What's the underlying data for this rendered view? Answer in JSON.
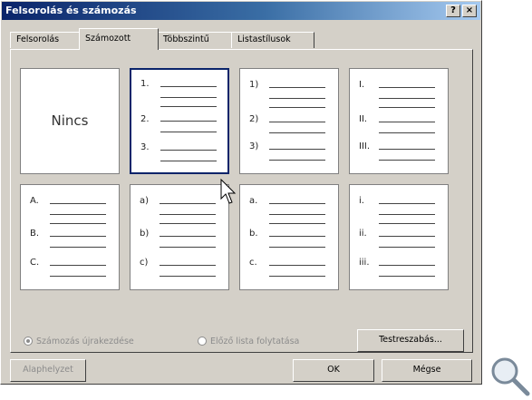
{
  "window": {
    "title": "Felsorolás és számozás",
    "help_icon": "?",
    "close_icon": "×"
  },
  "tabs": [
    {
      "label": "Felsorolás"
    },
    {
      "label": "Számozott"
    },
    {
      "label": "Többszintű"
    },
    {
      "label": "Listastílusok"
    }
  ],
  "gallery": {
    "none_label": "Nincs",
    "row1": [
      {
        "markers": [
          "1.",
          "2.",
          "3."
        ]
      },
      {
        "markers": [
          "1)",
          "2)",
          "3)"
        ]
      },
      {
        "markers": [
          "I.",
          "II.",
          "III."
        ]
      }
    ],
    "row2": [
      {
        "markers": [
          "A.",
          "B.",
          "C."
        ]
      },
      {
        "markers": [
          "a)",
          "b)",
          "c)"
        ]
      },
      {
        "markers": [
          "a.",
          "b.",
          "c."
        ]
      },
      {
        "markers": [
          "i.",
          "ii.",
          "iii."
        ]
      }
    ]
  },
  "options": {
    "restart_label": "Számozás újrakezdése",
    "continue_label": "Előző lista folytatása"
  },
  "buttons": {
    "customize": "Testreszabás...",
    "reset": "Alaphelyzet",
    "ok": "OK",
    "cancel": "Mégse"
  },
  "colors": {
    "title_start": "#0a246a",
    "title_end": "#a6caf0",
    "selection": "#0a246a",
    "face": "#d4d0c8"
  }
}
